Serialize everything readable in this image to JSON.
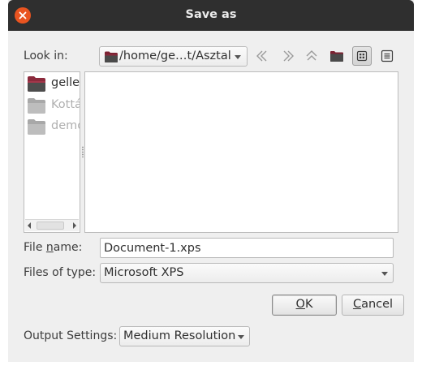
{
  "dialog": {
    "title": "Save as",
    "close_icon": "close-icon"
  },
  "look_in": {
    "label": "Look in:",
    "path": "/home/ge…t/Asztal"
  },
  "toolbar": {
    "icons": [
      "back-icon",
      "forward-icon",
      "parent-directory-icon",
      "new-folder-icon",
      "icon-view-icon",
      "detail-view-icon"
    ]
  },
  "sidebar": {
    "items": [
      {
        "label": "geller",
        "icon": "home-folder-icon"
      },
      {
        "label": "Kottá",
        "icon": "folder-icon"
      },
      {
        "label": "demo",
        "icon": "folder-icon"
      }
    ]
  },
  "file_name": {
    "label_prefix": "File ",
    "label_accel": "n",
    "label_suffix": "ame:",
    "value": "Document-1.xps"
  },
  "file_type": {
    "label": "Files of type:",
    "selected": "Microsoft XPS"
  },
  "buttons": {
    "ok_accel": "O",
    "ok_rest": "K",
    "cancel_accel": "C",
    "cancel_rest": "ancel"
  },
  "output_settings": {
    "label": "Output Settings:",
    "selected": "Medium Resolution"
  },
  "colors": {
    "titlebar": "#2f2f2f",
    "close_button": "#e95420",
    "dialog_background": "#efefef",
    "home_folder": "#8b2a3c",
    "disabled_folder": "#b5b5b5"
  }
}
